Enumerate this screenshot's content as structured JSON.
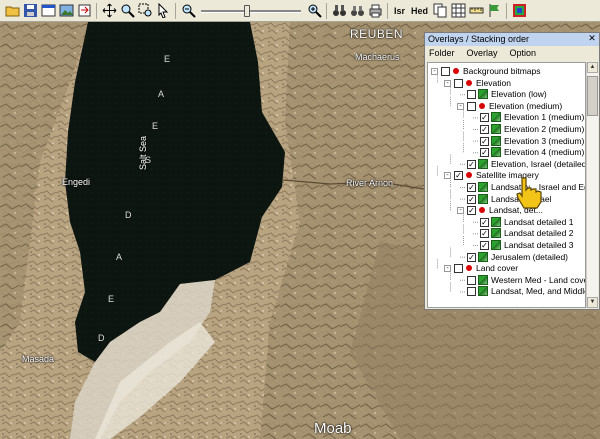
{
  "toolbar": {
    "items": [
      {
        "icon": "open-folder-icon"
      },
      {
        "icon": "save-icon"
      },
      {
        "icon": "window-icon"
      },
      {
        "icon": "image-icon"
      },
      {
        "icon": "export-icon"
      },
      {
        "icon": "move-icon"
      },
      {
        "icon": "zoom-icon"
      },
      {
        "icon": "zoom-area-icon"
      },
      {
        "icon": "select-arrow-icon"
      },
      {
        "icon": "zoom-out-icon"
      },
      {
        "icon": "zoom-in-icon"
      },
      {
        "icon": "binoculars-icon"
      },
      {
        "icon": "binoculars-alt-icon"
      },
      {
        "icon": "print-icon"
      },
      {
        "icon": "copy-icon"
      },
      {
        "icon": "text-icon"
      },
      {
        "icon": "grid-icon"
      },
      {
        "icon": "ruler-icon"
      },
      {
        "icon": "flag-icon"
      },
      {
        "icon": "layers-icon"
      }
    ],
    "isr_label": "Isr",
    "hed_label": "Hed",
    "zoom_level": 0.46
  },
  "map": {
    "labels": {
      "reuben": "REUBEN",
      "machaerus": "Machaerus",
      "engedi": "Engedi",
      "salt_sea": "Salt Sea",
      "river_arnon": "River Arnon",
      "masada": "Masada",
      "moab": "Moab"
    },
    "dead_sea_letters": [
      "E",
      "A",
      "E",
      "S",
      "D",
      "A",
      "E",
      "D"
    ]
  },
  "panel": {
    "title": "Overlays / Stacking order",
    "menu": [
      "Folder",
      "Overlay",
      "Option"
    ],
    "tree": [
      {
        "label": "Background bitmaps",
        "level": 0,
        "expander": "-",
        "checked": false,
        "icon": "red"
      },
      {
        "label": "Elevation",
        "level": 1,
        "expander": "-",
        "checked": false,
        "icon": "red"
      },
      {
        "label": "Elevation (low)",
        "level": 2,
        "expander": "",
        "checked": false,
        "icon": "map"
      },
      {
        "label": "Elevation (medium)",
        "level": 2,
        "expander": "-",
        "checked": false,
        "icon": "red"
      },
      {
        "label": "Elevation 1 (medium)",
        "level": 3,
        "expander": "",
        "checked": true,
        "icon": "map"
      },
      {
        "label": "Elevation 2 (medium)",
        "level": 3,
        "expander": "",
        "checked": true,
        "icon": "map"
      },
      {
        "label": "Elevation 3 (medium)",
        "level": 3,
        "expander": "",
        "checked": true,
        "icon": "map"
      },
      {
        "label": "Elevation 4 (medium)",
        "level": 3,
        "expander": "",
        "checked": true,
        "icon": "map"
      },
      {
        "label": "Elevation, Israel (detailed)",
        "level": 2,
        "expander": "",
        "checked": true,
        "icon": "map"
      },
      {
        "label": "Satellite imagery",
        "level": 1,
        "expander": "-",
        "checked": true,
        "icon": "red"
      },
      {
        "label": "Landsat w... Israel and Eg",
        "level": 2,
        "expander": "",
        "checked": true,
        "icon": "map"
      },
      {
        "label": "Landsat... Israel",
        "level": 2,
        "expander": "",
        "checked": true,
        "icon": "map"
      },
      {
        "label": "Landsat, det...",
        "level": 2,
        "expander": "-",
        "checked": true,
        "icon": "red"
      },
      {
        "label": "Landsat detailed 1",
        "level": 3,
        "expander": "",
        "checked": true,
        "icon": "map"
      },
      {
        "label": "Landsat detailed 2",
        "level": 3,
        "expander": "",
        "checked": true,
        "icon": "map"
      },
      {
        "label": "Landsat detailed 3",
        "level": 3,
        "expander": "",
        "checked": true,
        "icon": "map"
      },
      {
        "label": "Jerusalem (detailed)",
        "level": 2,
        "expander": "",
        "checked": true,
        "icon": "map"
      },
      {
        "label": "Land cover",
        "level": 1,
        "expander": "-",
        "checked": false,
        "icon": "red"
      },
      {
        "label": "Western Med - Land cover",
        "level": 2,
        "expander": "",
        "checked": false,
        "icon": "map"
      },
      {
        "label": "Landsat, Med, and Middle E",
        "level": 2,
        "expander": "",
        "checked": false,
        "icon": "map"
      }
    ]
  }
}
